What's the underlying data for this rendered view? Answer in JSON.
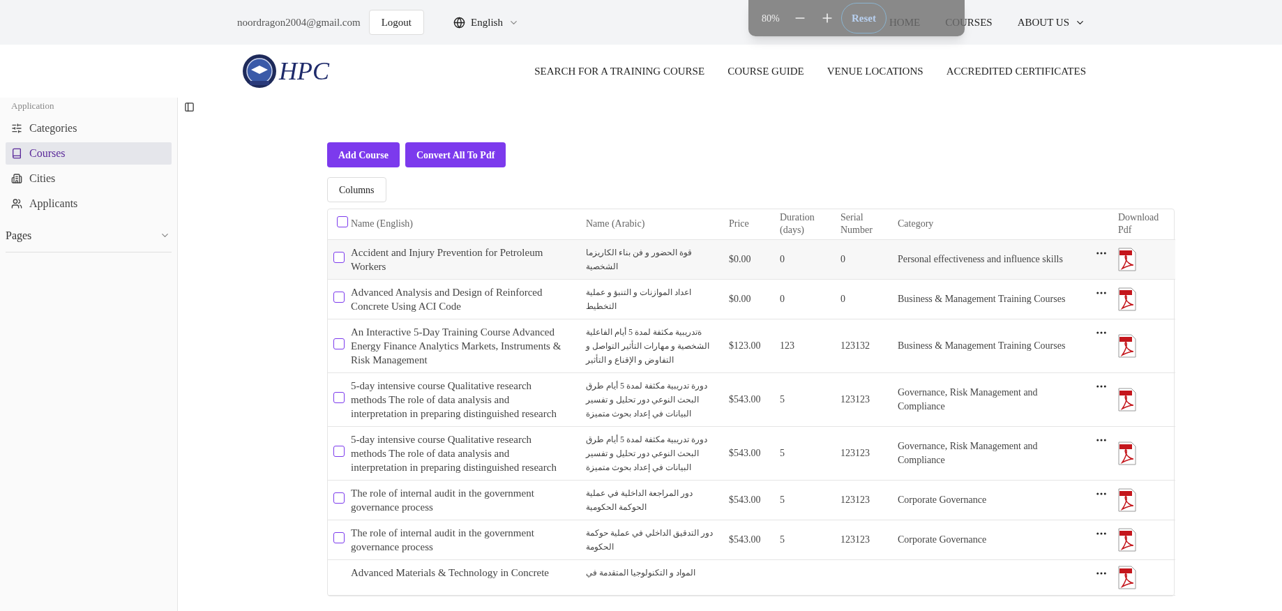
{
  "top_bar": {
    "email": "noordragon2004@gmail.com",
    "logout": "Logout",
    "language": "English",
    "nav": [
      {
        "label": "HOME",
        "dropdown": false
      },
      {
        "label": "COURSES",
        "dropdown": false
      },
      {
        "label": "ABOUT US",
        "dropdown": true
      }
    ]
  },
  "zoom_overlay": {
    "percent": "80%",
    "reset": "Reset"
  },
  "header": {
    "logo_text": "HPC",
    "nav": [
      "SEARCH FOR A TRAINING COURSE",
      "COURSE GUIDE",
      "VENUE LOCATIONS",
      "ACCREDITED CERTIFICATES"
    ]
  },
  "sidebar": {
    "group": "Application",
    "items": [
      {
        "label": "Categories",
        "kind": "sliders",
        "selected": false
      },
      {
        "label": "Courses",
        "kind": "book",
        "selected": true
      },
      {
        "label": "Cities",
        "kind": "city",
        "selected": false
      },
      {
        "label": "Applicants",
        "kind": "users",
        "selected": false
      }
    ],
    "section": {
      "label": "Pages",
      "expanded": false
    }
  },
  "actions": [
    "Add Course",
    "Convert All To Pdf"
  ],
  "columns_button": "Columns",
  "table": {
    "select_all": {
      "checked": false
    },
    "columns": [
      "Name (English)",
      "Name (Arabic)",
      "Price",
      "Duration (days)",
      "Serial Number",
      "Category",
      "Download Pdf"
    ],
    "rows": [
      {
        "checked": false,
        "name_en": "Accident and Injury Prevention for Petroleum Workers",
        "name_ar": "قوة الحضور و فن بناء الكاريزما الشخصية",
        "price": "$0.00",
        "duration": "0",
        "serial": "0",
        "category": "Personal effectiveness and influence skills"
      },
      {
        "checked": false,
        "name_en": "Advanced Analysis and Design of Reinforced Concrete Using ACI Code",
        "name_ar": "اعداد الموازنات و التنبؤ و عملية التخطيط",
        "price": "$0.00",
        "duration": "0",
        "serial": "0",
        "category": "Business & Management Training Courses"
      },
      {
        "checked": false,
        "name_en": "An Interactive 5-Day Training Course Advanced Energy Finance Analytics Markets, Instruments & Risk Management",
        "name_ar": "ةتدريبية مكثفة لمدة 5 أيام الفاعلية الشخصية و مهارات التأثير التواصل و التفاوض و الإقناع و التأثير",
        "price": "$123.00",
        "duration": "123",
        "serial": "123132",
        "category": "Business & Management Training Courses"
      },
      {
        "checked": false,
        "name_en": "5-day intensive course Qualitative research methods The role of data analysis and interpretation in preparing distinguished research",
        "name_ar": "دورة تدريبية مكثفة لمدة 5 أيام طرق البحث النوعي دور تحليل و تفسير البيانات في إعداد بحوث متميزة",
        "price": "$543.00",
        "duration": "5",
        "serial": "123123",
        "category": "Governance, Risk Management and Compliance"
      },
      {
        "checked": false,
        "name_en": "5-day intensive course Qualitative research methods The role of data analysis and interpretation in preparing distinguished research",
        "name_ar": "دورة تدريبية مكثفة لمدة 5 أيام طرق البحث النوعي دور تحليل و تفسير البيانات في إعداد بحوث متميزة",
        "price": "$543.00",
        "duration": "5",
        "serial": "123123",
        "category": "Governance, Risk Management and Compliance"
      },
      {
        "checked": false,
        "name_en": "The role of internal audit in the government governance process",
        "name_ar": "دور المراجعة الداخلية في عملية الحوكمة الحكومية",
        "price": "$543.00",
        "duration": "5",
        "serial": "123123",
        "category": "Corporate Governance"
      },
      {
        "checked": false,
        "name_en": "The role of internal audit in the government governance process",
        "name_ar": "دور التدقيق الداخلي في عملية حوكمة الحكومة",
        "price": "$543.00",
        "duration": "5",
        "serial": "123123",
        "category": "Corporate Governance"
      },
      {
        "name_en": "Advanced Materials & Technology in Concrete",
        "name_ar": "المواد و التكنولوجيا المتقدمة في"
      }
    ]
  }
}
